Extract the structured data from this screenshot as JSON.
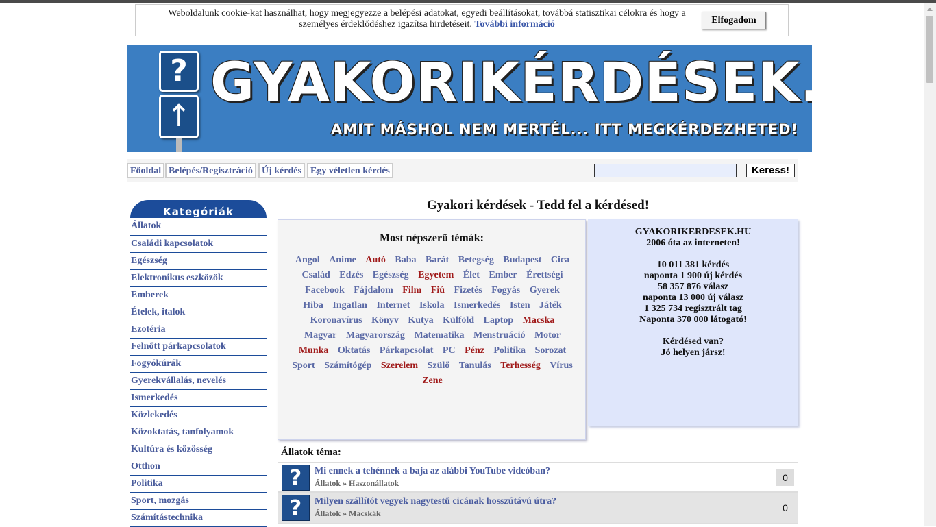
{
  "cookie": {
    "text": "Weboldalunk cookie-kat használhat, hogy megjegyezze a belépési adatokat, egyedi beállításokat, továbbá statisztikai célokra és hogy a személyes érdeklődéshez igazítsa hirdetéseit.",
    "more_link": "További információ",
    "accept_button": "Elfogadom"
  },
  "banner": {
    "site_title": "GYAKORIKÉRDÉSEK.HU",
    "slogan": "Amit máshol nem mertél... itt megkérdezheted!",
    "sign_question": "?",
    "sign_arrow": "↑"
  },
  "nav": {
    "items": [
      "Főoldal",
      "Belépés/Regisztráció",
      "Új kérdés",
      "Egy véletlen kérdés"
    ],
    "search_placeholder": "",
    "search_button": "Keress!"
  },
  "categories": {
    "title": "Kategóriák",
    "items": [
      "Állatok",
      "Családi kapcsolatok",
      "Egészség",
      "Elektronikus eszközök",
      "Emberek",
      "Ételek, italok",
      "Ezotéria",
      "Felnőtt párkapcsolatok",
      "Fogyókúrák",
      "Gyerekvállalás, nevelés",
      "Ismerkedés",
      "Közlekedés",
      "Közoktatás, tanfolyamok",
      "Kultúra és közösség",
      "Otthon",
      "Politika",
      "Sport, mozgás",
      "Számítástechnika"
    ]
  },
  "main": {
    "title": "Gyakori kérdések - Tedd fel a kérdésed!",
    "popular_title": "Most népszerű témák:",
    "tags": [
      {
        "t": "Angol",
        "hot": false
      },
      {
        "t": "Anime",
        "hot": false
      },
      {
        "t": "Autó",
        "hot": true
      },
      {
        "t": "Baba",
        "hot": false
      },
      {
        "t": "Barát",
        "hot": false
      },
      {
        "t": "Betegség",
        "hot": false
      },
      {
        "t": "Budapest",
        "hot": false
      },
      {
        "t": "Cica",
        "hot": false
      },
      {
        "t": "Család",
        "hot": false
      },
      {
        "t": "Edzés",
        "hot": false
      },
      {
        "t": "Egészség",
        "hot": false
      },
      {
        "t": "Egyetem",
        "hot": true
      },
      {
        "t": "Élet",
        "hot": false
      },
      {
        "t": "Ember",
        "hot": false
      },
      {
        "t": "Érettségi",
        "hot": false
      },
      {
        "t": "Facebook",
        "hot": false
      },
      {
        "t": "Fájdalom",
        "hot": false
      },
      {
        "t": "Film",
        "hot": true
      },
      {
        "t": "Fiú",
        "hot": true
      },
      {
        "t": "Fizetés",
        "hot": false
      },
      {
        "t": "Fogyás",
        "hot": false
      },
      {
        "t": "Gyerek",
        "hot": false
      },
      {
        "t": "Hiba",
        "hot": false
      },
      {
        "t": "Ingatlan",
        "hot": false
      },
      {
        "t": "Internet",
        "hot": false
      },
      {
        "t": "Iskola",
        "hot": false
      },
      {
        "t": "Ismerkedés",
        "hot": false
      },
      {
        "t": "Isten",
        "hot": false
      },
      {
        "t": "Játék",
        "hot": false
      },
      {
        "t": "Koronavírus",
        "hot": false
      },
      {
        "t": "Könyv",
        "hot": false
      },
      {
        "t": "Kutya",
        "hot": false
      },
      {
        "t": "Külföld",
        "hot": false
      },
      {
        "t": "Laptop",
        "hot": false
      },
      {
        "t": "Macska",
        "hot": true
      },
      {
        "t": "Magyar",
        "hot": false
      },
      {
        "t": "Magyarország",
        "hot": false
      },
      {
        "t": "Matematika",
        "hot": false
      },
      {
        "t": "Menstruáció",
        "hot": false
      },
      {
        "t": "Motor",
        "hot": false
      },
      {
        "t": "Munka",
        "hot": true
      },
      {
        "t": "Oktatás",
        "hot": false
      },
      {
        "t": "Párkapcsolat",
        "hot": false
      },
      {
        "t": "PC",
        "hot": false
      },
      {
        "t": "Pénz",
        "hot": true
      },
      {
        "t": "Politika",
        "hot": false
      },
      {
        "t": "Sorozat",
        "hot": false
      },
      {
        "t": "Sport",
        "hot": false
      },
      {
        "t": "Számítógép",
        "hot": false
      },
      {
        "t": "Szerelem",
        "hot": true
      },
      {
        "t": "Szülő",
        "hot": false
      },
      {
        "t": "Tanulás",
        "hot": false
      },
      {
        "t": "Terhesség",
        "hot": true
      },
      {
        "t": "Vírus",
        "hot": false
      },
      {
        "t": "Zene",
        "hot": true
      }
    ],
    "stats": {
      "lines": [
        "GYAKORIKERDESEK.HU",
        "2006 óta az interneten!",
        "",
        "10 011 381 kérdés",
        "naponta 1 900 új kérdés",
        "58 357 876 válasz",
        "naponta 13 000 új válasz",
        "1 325 734 regisztrált tag",
        "Naponta 370 000 látogató!",
        "",
        "Kérdésed van?",
        "Jó helyen jársz!"
      ]
    },
    "section_title": "Állatok téma:",
    "questions": [
      {
        "title": "Mi ennek a tehénnek a baja az alábbi YouTube videóban?",
        "category": "Állatok » Haszonállatok",
        "answers": "0"
      },
      {
        "title": "Milyen szállítót vegyek nagytestű cicának hosszútávú útra?",
        "category": "Állatok » Macskák",
        "answers": "0"
      }
    ]
  }
}
